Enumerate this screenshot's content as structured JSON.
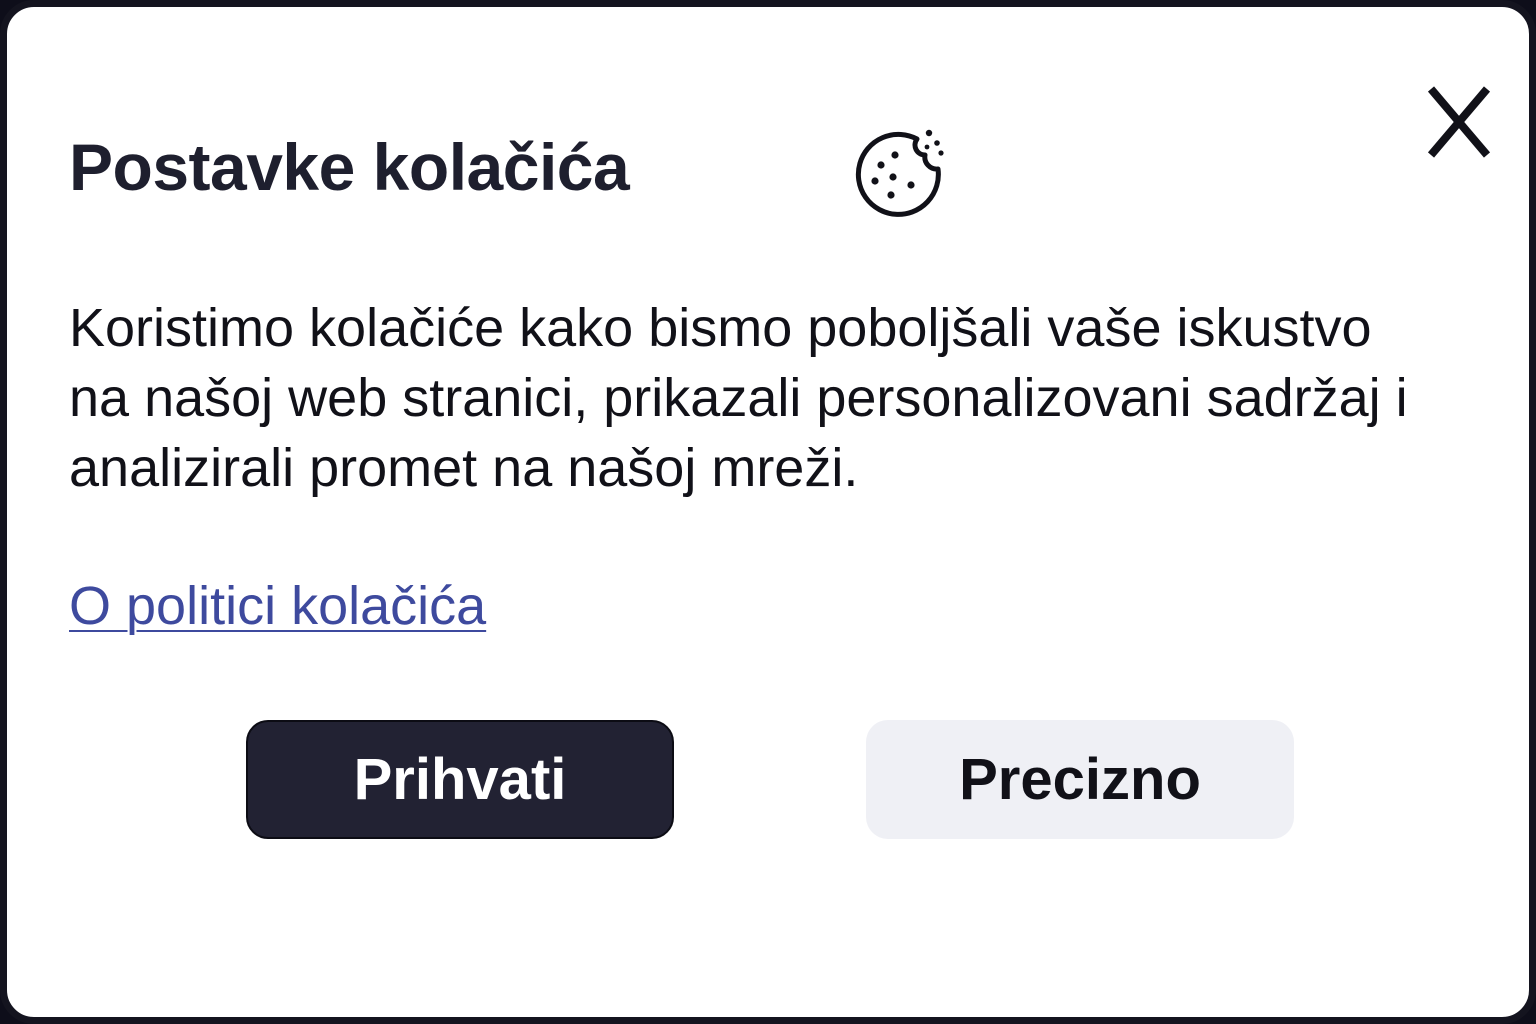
{
  "dialog": {
    "title": "Postavke kolačića",
    "title_icon": "cookie-icon",
    "close_label": "X",
    "description_lines": [
      "Koristimo kolačiće kako bismo poboljšali vaše iskustvo",
      "na našoj web stranici, prikazali personalizovani sadržaj i",
      "analizirali promet na našoj mreži."
    ],
    "policy_link_label": "O politici kolačića",
    "accept_button_label": "Prihvati",
    "precise_button_label": "Precizno"
  },
  "colors": {
    "title": "#1e1f2e",
    "link": "#3e4a9e",
    "accept_button_bg": "#222233",
    "precise_button_bg": "#eff0f5",
    "border": "#14141f"
  }
}
